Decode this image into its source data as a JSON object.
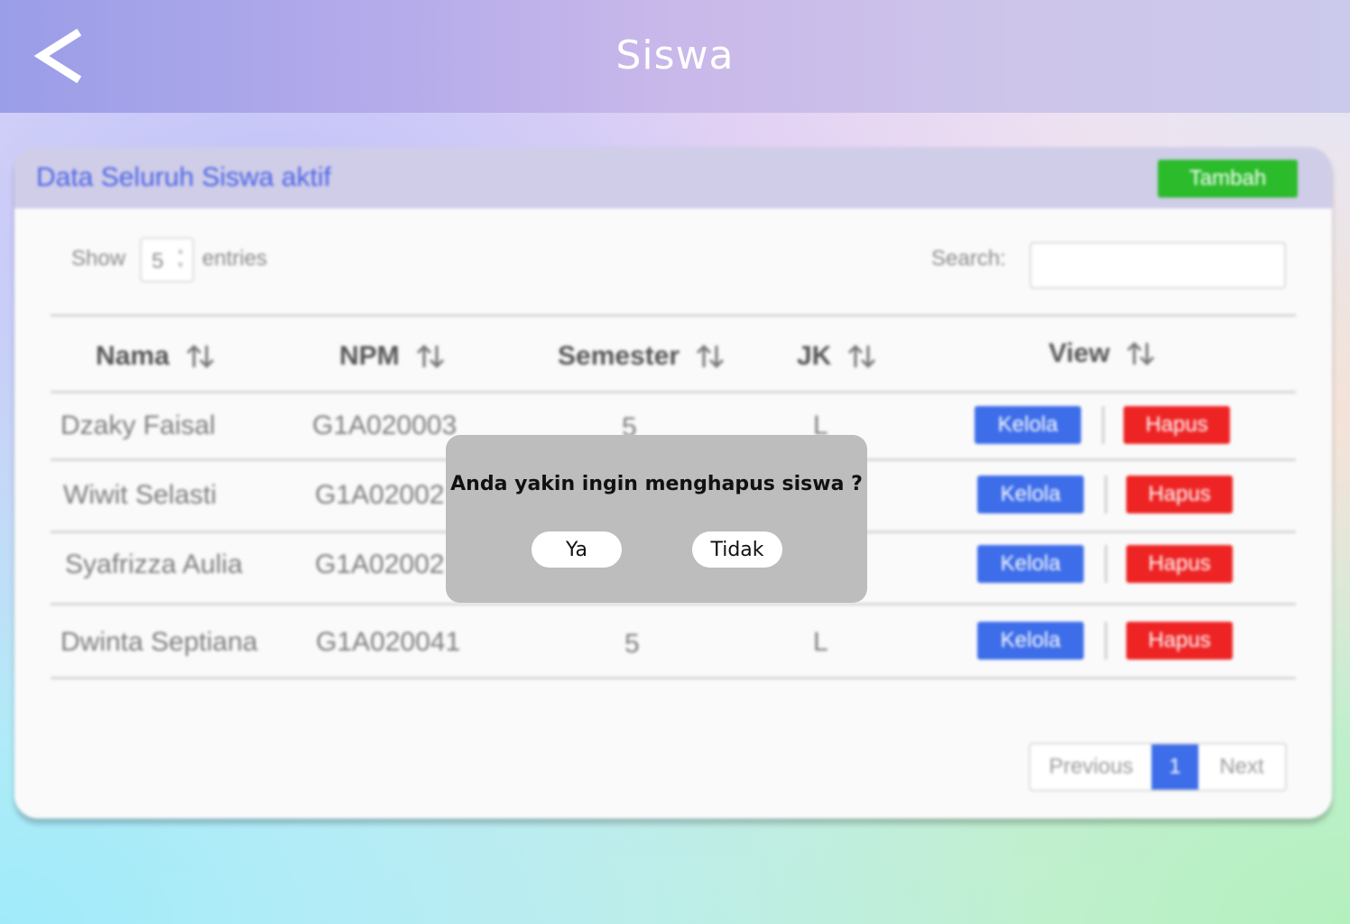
{
  "header": {
    "title": "Siswa"
  },
  "card": {
    "title": "Data Seluruh Siswa aktif",
    "add_button": "Tambah",
    "show_label": "Show",
    "entries_value": "5",
    "entries_label": "entries",
    "search_label": "Search:",
    "search_value": ""
  },
  "table": {
    "columns": [
      "Nama",
      "NPM",
      "Semester",
      "JK",
      "View"
    ],
    "rows": [
      {
        "nama": "Dzaky Faisal",
        "npm": "G1A020003",
        "semester": "5",
        "jk": "L",
        "kelola": "Kelola",
        "hapus": "Hapus"
      },
      {
        "nama": "Wiwit Selasti",
        "npm": "G1A02002",
        "semester": "",
        "jk": "",
        "kelola": "Kelola",
        "hapus": "Hapus"
      },
      {
        "nama": "Syafrizza Aulia",
        "npm": "G1A02002",
        "semester": "",
        "jk": "",
        "kelola": "Kelola",
        "hapus": "Hapus"
      },
      {
        "nama": "Dwinta Septiana",
        "npm": "G1A020041",
        "semester": "5",
        "jk": "L",
        "kelola": "Kelola",
        "hapus": "Hapus"
      }
    ]
  },
  "pagination": {
    "previous": "Previous",
    "current": "1",
    "next": "Next"
  },
  "dialog": {
    "message": "Anda yakin ingin menghapus siswa ?",
    "yes": "Ya",
    "no": "Tidak"
  },
  "colors": {
    "header_start": "#9a9de8",
    "header_end": "#cbc9ec",
    "primary_blue": "#3d6de9",
    "danger_red": "#ee2424",
    "success_green": "#2bbb2b",
    "dialog_bg": "#bdbdbd"
  },
  "icons": {
    "back": "chevron-left-icon",
    "sort": "sort-arrows-icon"
  }
}
